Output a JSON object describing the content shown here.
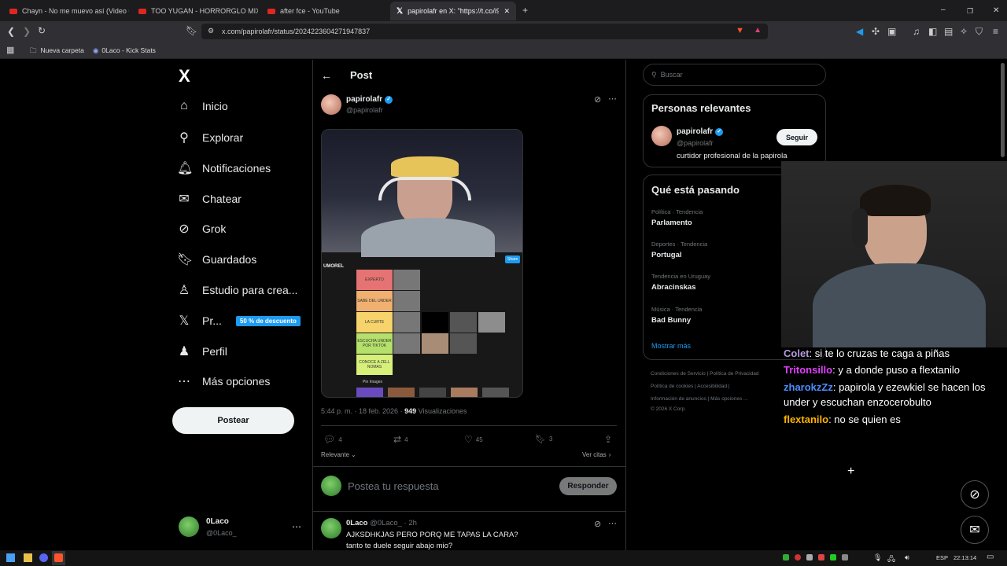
{
  "browser": {
    "tabs": [
      {
        "title": "Chayn - No me muevo así (Video Ofi",
        "type": "youtube"
      },
      {
        "title": "TOO YUGAN - HORRORGLO MIXTAP",
        "type": "youtube"
      },
      {
        "title": "after fce - YouTube",
        "type": "youtube"
      },
      {
        "title": "papirolafr en X: \"https://t.co/i9U",
        "type": "x",
        "active": true
      }
    ],
    "new_tab": "+",
    "url": "x.com/papirolafr/status/2024223604271947837",
    "bookmarks": [
      "Nueva carpeta",
      "0Laco - Kick Stats"
    ]
  },
  "sidebar": {
    "logo": "X",
    "items": [
      {
        "label": "Inicio",
        "icon": "home-icon",
        "glyph": "⌂"
      },
      {
        "label": "Explorar",
        "icon": "search-icon",
        "glyph": "⚲"
      },
      {
        "label": "Notificaciones",
        "icon": "bell-icon",
        "glyph": "🔔︎"
      },
      {
        "label": "Chatear",
        "icon": "mail-icon",
        "glyph": "✉"
      },
      {
        "label": "Grok",
        "icon": "grok-icon",
        "glyph": "⊘"
      },
      {
        "label": "Guardados",
        "icon": "bookmark-icon",
        "glyph": "🔖︎"
      },
      {
        "label": "Estudio para crea...",
        "icon": "studio-icon",
        "glyph": "♙"
      },
      {
        "label": "Pr...",
        "icon": "premium-icon",
        "glyph": "𝕏"
      },
      {
        "label": "Perfil",
        "icon": "profile-icon",
        "glyph": "♟"
      },
      {
        "label": "Más opciones",
        "icon": "more-icon",
        "glyph": "⋯"
      }
    ],
    "promo": "50 % de descuento",
    "post_button": "Postear",
    "account": {
      "name": "0Laco",
      "handle": "@0Laco_"
    }
  },
  "post": {
    "header": "Post",
    "author": {
      "name": "papirolafr",
      "handle": "@papirolafr"
    },
    "media_labels": {
      "tier_title": "UMOREL",
      "share": "Share",
      "pin": "Pin Images"
    },
    "tiers": [
      "EXPERTO",
      "SABE DEL UNDER",
      "LA CURTE",
      "ESCUCHA UNDER POR TIKTOK",
      "CONOCE A ZELL NOMAS"
    ],
    "meta": {
      "time": "5:44 p. m. · 18 feb. 2026 ·",
      "views": "949",
      "views_label": "Visualizaciones"
    },
    "actions": {
      "replies": "4",
      "reposts": "4",
      "likes": "45",
      "bookmarks": "3"
    },
    "sort": "Relevante",
    "quotes": "Ver citas",
    "reply_placeholder": "Postea tu respuesta",
    "reply_button": "Responder"
  },
  "reply": {
    "name": "0Laco",
    "handle": "@0Laco_ · 2h",
    "line1": "AJKSDHKJAS PERO PORQ ME TAPAS LA CARA?",
    "line2": "tanto te duele seguir abajo mio?"
  },
  "right": {
    "search_placeholder": "Buscar",
    "relevant": {
      "title": "Personas relevantes",
      "name": "papirolafr",
      "handle": "@papirolafr",
      "bio": "curtidor profesional de la papirola",
      "follow": "Seguir"
    },
    "trends_title": "Qué está pasando",
    "trends": [
      {
        "meta": "Política · Tendencia",
        "name": "Parlamento"
      },
      {
        "meta": "Deportes · Tendencia",
        "name": "Portugal"
      },
      {
        "meta": "Tendencia en Uruguay",
        "name": "Abracinskas"
      },
      {
        "meta": "Música · Tendencia",
        "name": "Bad Bunny"
      }
    ],
    "show_more": "Mostrar más",
    "footer": [
      "Condiciones de Servicio  |  Política de Privacidad",
      "Política de cookies  |  Accesibilidad  |",
      "Información de anuncios  |  Más opciones ...",
      "© 2026 X Corp."
    ]
  },
  "stream_chat": [
    {
      "user": "Colet",
      "color": "#b39ddb",
      "msg": ": si te lo cruzas te caga a piñas"
    },
    {
      "user": "Tritonsillo",
      "color": "#e040fb",
      "msg": ": y a donde puso a flextanilo"
    },
    {
      "user": "zharokzZz",
      "color": "#4d8eff",
      "msg": ": papirola y ezewkiel se hacen los"
    },
    {
      "user": "",
      "color": "#ffffff",
      "msg": "under y escuchan enzocerobulto"
    },
    {
      "user": "flextanilo",
      "color": "#ffb300",
      "msg": ": no se quien es"
    }
  ],
  "taskbar": {
    "lang": "ESP",
    "clock": "22:13:14"
  }
}
